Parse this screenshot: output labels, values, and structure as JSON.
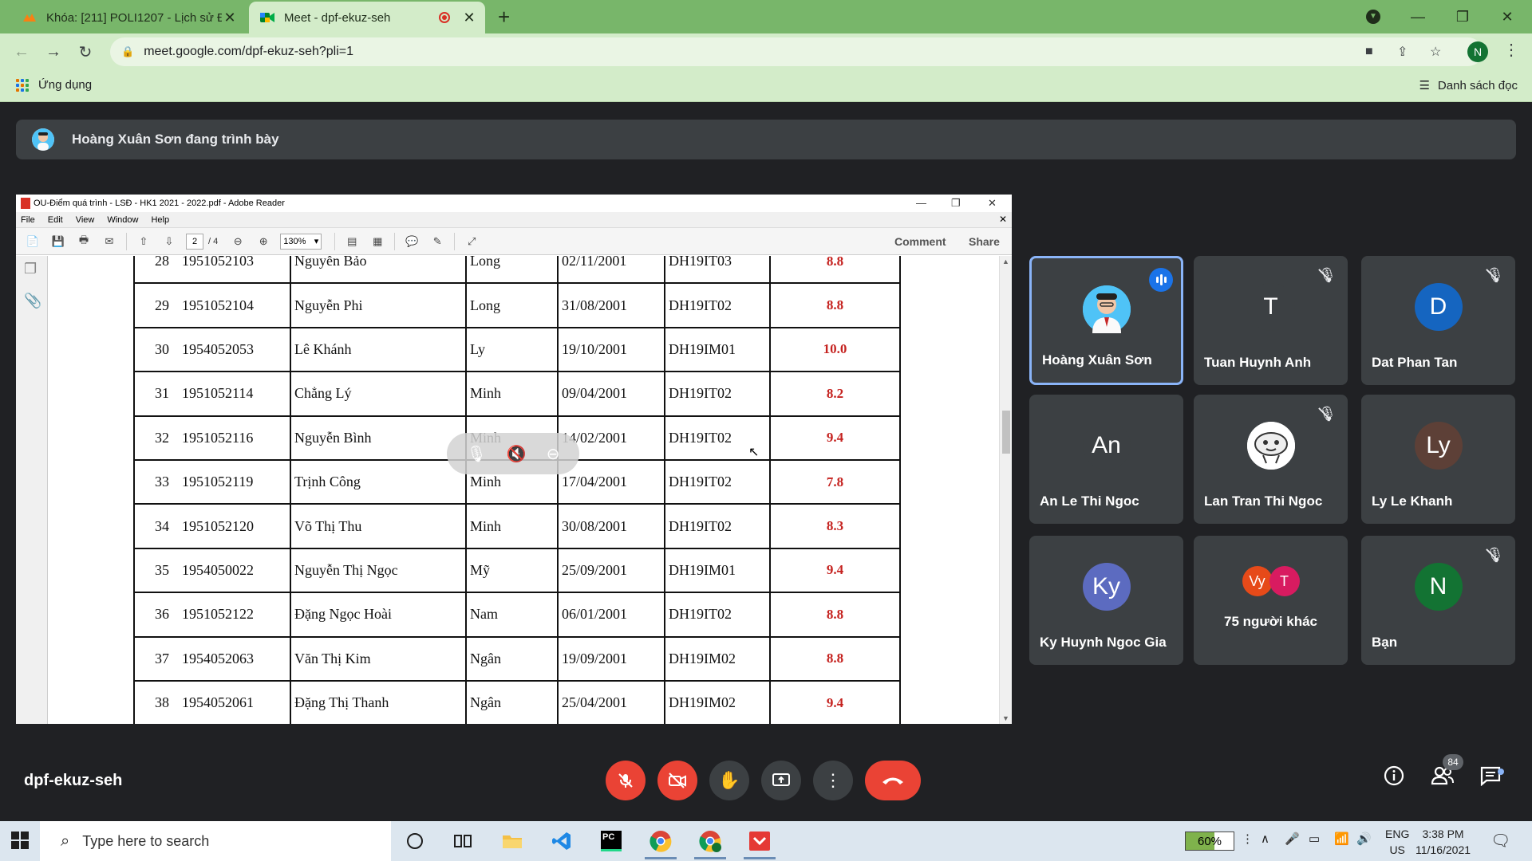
{
  "browser": {
    "tabs": [
      {
        "title": "Khóa: [211] POLI1207 - Lịch sử Đ",
        "active": false
      },
      {
        "title": "Meet - dpf-ekuz-seh",
        "active": true
      }
    ],
    "url": "meet.google.com/dpf-ekuz-seh?pli=1",
    "profile_initial": "N",
    "bookmarks": {
      "apps_label": "Ứng dụng",
      "reading_list_label": "Danh sách đọc"
    }
  },
  "meet": {
    "presenting_text": "Hoàng Xuân Sơn đang trình bày",
    "meeting_code": "dpf-ekuz-seh",
    "participant_count": "84",
    "participants": [
      {
        "name": "Hoàng Xuân Sơn",
        "initial": "",
        "color": "#4fc3f7",
        "muted": false,
        "speaking": true
      },
      {
        "name": "Tuan Huynh Anh",
        "initial": "T",
        "color": "#3c4043",
        "muted": true,
        "speaking": false
      },
      {
        "name": "Dat Phan Tan",
        "initial": "D",
        "color": "#1565c0",
        "muted": true,
        "speaking": false
      },
      {
        "name": "An Le Thi Ngoc",
        "initial": "An",
        "color": "#3c4043",
        "muted": false,
        "speaking": false
      },
      {
        "name": "Lan Tran Thi Ngoc",
        "initial": "",
        "color": "#ffffff",
        "muted": true,
        "speaking": false
      },
      {
        "name": "Ly Le Khanh",
        "initial": "Ly",
        "color": "#5d4037",
        "muted": false,
        "speaking": false
      },
      {
        "name": "Ky Huynh Ngoc Gia",
        "initial": "Ky",
        "color": "#5c6bc0",
        "muted": false,
        "speaking": false
      },
      {
        "name": "75 người khác",
        "initial": "",
        "color": "#3c4043",
        "muted": false,
        "speaking": false
      },
      {
        "name": "Bạn",
        "initial": "N",
        "color": "#137333",
        "muted": true,
        "speaking": false
      }
    ],
    "others_avatars": [
      {
        "initial": "Vy",
        "color": "#e64a19"
      },
      {
        "initial": "T",
        "color": "#d81b60"
      }
    ]
  },
  "reader": {
    "window_title": "OU-Điểm quá trình - LSĐ - HK1 2021 - 2022.pdf - Adobe Reader",
    "menu": [
      "File",
      "Edit",
      "View",
      "Window",
      "Help"
    ],
    "page_current": "2",
    "page_total": "/ 4",
    "zoom": "130%",
    "comment_label": "Comment",
    "share_label": "Share",
    "rows": [
      {
        "stt": "28",
        "mssv": "1951052103",
        "ho": "Nguyễn Bảo",
        "ten": "Long",
        "ngay_sinh": "02/11/2001",
        "lop": "DH19IT03",
        "diem": "8.8"
      },
      {
        "stt": "29",
        "mssv": "1951052104",
        "ho": "Nguyễn Phi",
        "ten": "Long",
        "ngay_sinh": "31/08/2001",
        "lop": "DH19IT02",
        "diem": "8.8"
      },
      {
        "stt": "30",
        "mssv": "1954052053",
        "ho": "Lê Khánh",
        "ten": "Ly",
        "ngay_sinh": "19/10/2001",
        "lop": "DH19IM01",
        "diem": "10.0"
      },
      {
        "stt": "31",
        "mssv": "1951052114",
        "ho": "Chẳng Lý",
        "ten": "Minh",
        "ngay_sinh": "09/04/2001",
        "lop": "DH19IT02",
        "diem": "8.2"
      },
      {
        "stt": "32",
        "mssv": "1951052116",
        "ho": "Nguyễn Bình",
        "ten": "Minh",
        "ngay_sinh": "14/02/2001",
        "lop": "DH19IT02",
        "diem": "9.4"
      },
      {
        "stt": "33",
        "mssv": "1951052119",
        "ho": "Trịnh Công",
        "ten": "Minh",
        "ngay_sinh": "17/04/2001",
        "lop": "DH19IT02",
        "diem": "7.8"
      },
      {
        "stt": "34",
        "mssv": "1951052120",
        "ho": "Võ Thị Thu",
        "ten": "Minh",
        "ngay_sinh": "30/08/2001",
        "lop": "DH19IT02",
        "diem": "8.3"
      },
      {
        "stt": "35",
        "mssv": "1954050022",
        "ho": "Nguyễn Thị Ngọc",
        "ten": "Mỹ",
        "ngay_sinh": "25/09/2001",
        "lop": "DH19IM01",
        "diem": "9.4"
      },
      {
        "stt": "36",
        "mssv": "1951052122",
        "ho": "Đặng Ngọc Hoài",
        "ten": "Nam",
        "ngay_sinh": "06/01/2001",
        "lop": "DH19IT02",
        "diem": "8.8"
      },
      {
        "stt": "37",
        "mssv": "1954052063",
        "ho": "Văn Thị Kim",
        "ten": "Ngân",
        "ngay_sinh": "19/09/2001",
        "lop": "DH19IM02",
        "diem": "8.8"
      },
      {
        "stt": "38",
        "mssv": "1954052061",
        "ho": "Đặng Thị Thanh",
        "ten": "Ngân",
        "ngay_sinh": "25/04/2001",
        "lop": "DH19IM02",
        "diem": "9.4"
      }
    ]
  },
  "taskbar": {
    "search_placeholder": "Type here to search",
    "battery": "60%",
    "lang_line1": "ENG",
    "lang_line2": "US",
    "time": "3:38 PM",
    "date": "11/16/2021"
  },
  "colors": {
    "chrome_accent": "#78b66a",
    "meet_bg": "#202124",
    "tile_bg": "#3c4043",
    "danger": "#ea4335",
    "grade": "#c5221f"
  }
}
